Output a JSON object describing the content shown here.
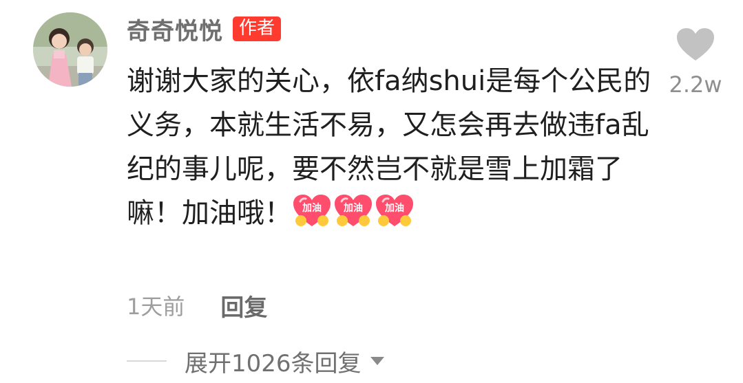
{
  "comment": {
    "author": {
      "name": "奇奇悦悦",
      "badge": "作者"
    },
    "text_segments": [
      "谢谢大家的关心，依fa纳shui是每个公民的义务，本就生活不易，又怎会再去做违fa乱纪的事儿呢，要不然岂不就是雪上加霜了嘛！加油哦！"
    ],
    "emoji": {
      "name": "jiayou-heart-emoji",
      "label": "加油",
      "count": 3,
      "color": "#ff4d6d"
    },
    "likes": {
      "count": "2.2w",
      "icon": "heart-icon"
    },
    "time": "1天前",
    "reply_label": "回复",
    "expand_replies_label": "展开1026条回复",
    "expand_icon": "caret-down-icon"
  },
  "colors": {
    "badge": "#ff3b30",
    "author_name": "#6f6f6f",
    "text": "#1f1f1f",
    "muted": "#9e9e9e"
  }
}
